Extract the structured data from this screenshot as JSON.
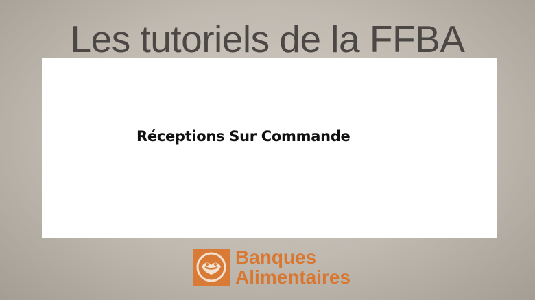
{
  "header": {
    "title": "Les tutoriels de la FFBA"
  },
  "panel": {
    "title": "Réceptions Sur Commande"
  },
  "logo": {
    "line1": "Banques",
    "line2": "Alimentaires",
    "mark": "banques-alimentaires-logo-icon"
  },
  "colors": {
    "brand_orange": "#d97b36",
    "title_gray": "#4a4744",
    "panel_bg": "#ffffff"
  }
}
